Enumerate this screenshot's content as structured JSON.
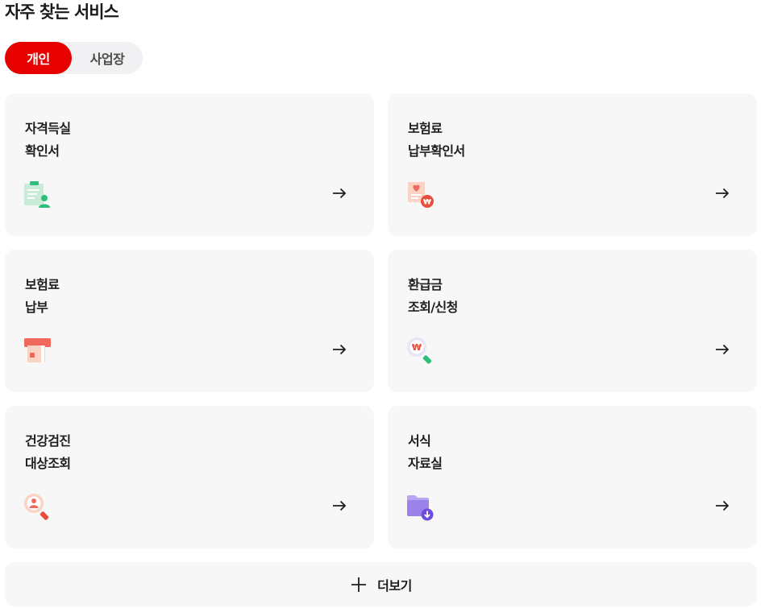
{
  "section": {
    "title": "자주 찾는 서비스"
  },
  "tabs": [
    {
      "label": "개인",
      "active": true
    },
    {
      "label": "사업장",
      "active": false
    }
  ],
  "cards": [
    {
      "line1": "자격득실",
      "line2": "확인서",
      "icon": "certificate-person-icon"
    },
    {
      "line1": "보험료",
      "line2": "납부확인서",
      "icon": "receipt-won-icon"
    },
    {
      "line1": "보험료",
      "line2": "납부",
      "icon": "card-payment-icon"
    },
    {
      "line1": "환급금",
      "line2": "조회/신청",
      "icon": "magnifier-won-icon"
    },
    {
      "line1": "건강검진",
      "line2": "대상조회",
      "icon": "magnifier-person-icon"
    },
    {
      "line1": "서식",
      "line2": "자료실",
      "icon": "folder-download-icon"
    }
  ],
  "more": {
    "label": "더보기",
    "icon": "plus-icon"
  },
  "colors": {
    "accent": "#e60000",
    "card_bg": "#f7f7f7",
    "toggle_bg": "#f1f1f3"
  }
}
